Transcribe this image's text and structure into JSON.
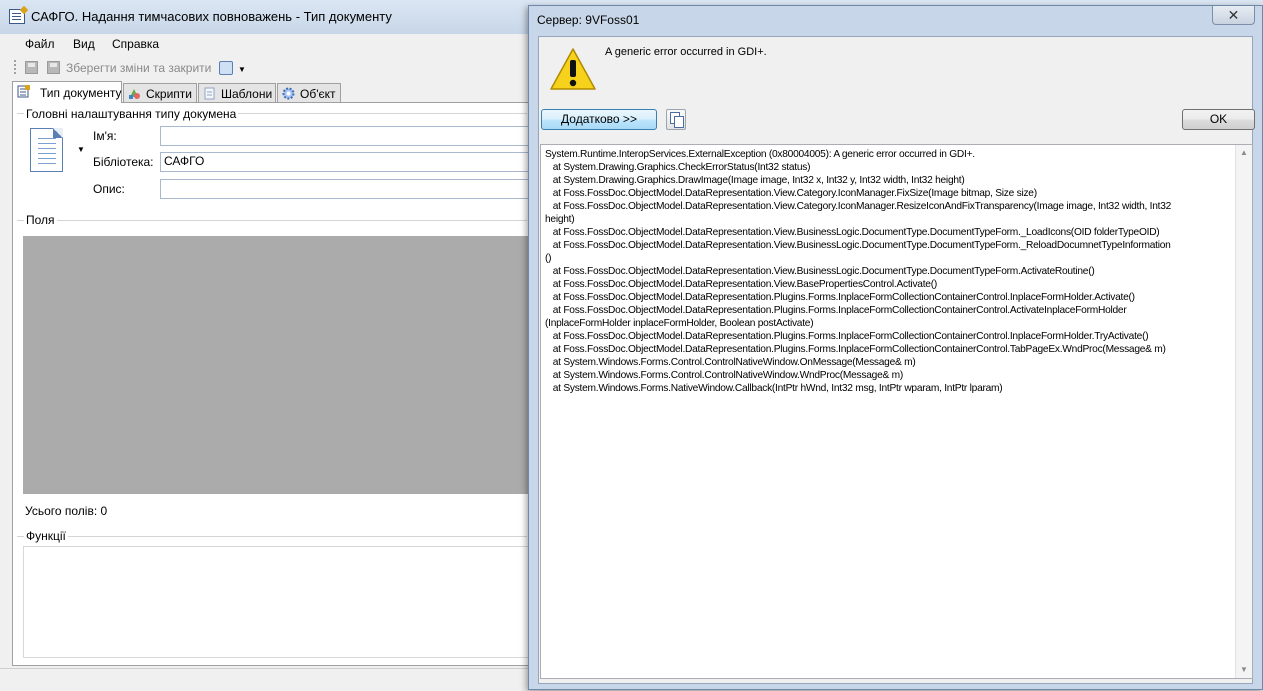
{
  "main_window": {
    "title": "САФГО. Надання тимчасових повноважень - Тип документу",
    "menu": [
      "Файл",
      "Вид",
      "Справка"
    ],
    "toolbar": {
      "save_close_label": "Зберегти зміни та закрити"
    },
    "tabs": [
      {
        "label": "Тип документу",
        "icon": "doc-type-icon",
        "active": true
      },
      {
        "label": "Скрипти",
        "icon": "scripts-icon",
        "active": false
      },
      {
        "label": "Шаблони",
        "icon": "templates-icon",
        "active": false
      },
      {
        "label": "Об'єкт",
        "icon": "object-icon",
        "active": false
      }
    ],
    "general": {
      "group_title": "Головні налаштування типу докумена",
      "name_label": "Ім'я:",
      "name_value": "",
      "library_label": "Бібліотека:",
      "library_value": "САФГО",
      "description_label": "Опис:",
      "description_value": ""
    },
    "fields": {
      "group_title": "Поля",
      "total_label": "Усього полів: 0"
    },
    "functions": {
      "group_title": "Функції"
    }
  },
  "dialog": {
    "title": "Сервер: 9VFoss01",
    "close_glyph": "✕",
    "message": "A generic error occurred in GDI+.",
    "more_button": "Додатково >>",
    "ok_button": "OK",
    "details": "System.Runtime.InteropServices.ExternalException (0x80004005): A generic error occurred in GDI+.\n   at System.Drawing.Graphics.CheckErrorStatus(Int32 status)\n   at System.Drawing.Graphics.DrawImage(Image image, Int32 x, Int32 y, Int32 width, Int32 height)\n   at Foss.FossDoc.ObjectModel.DataRepresentation.View.Category.IconManager.FixSize(Image bitmap, Size size)\n   at Foss.FossDoc.ObjectModel.DataRepresentation.View.Category.IconManager.ResizeIconAndFixTransparency(Image image, Int32 width, Int32\nheight)\n   at Foss.FossDoc.ObjectModel.DataRepresentation.View.BusinessLogic.DocumentType.DocumentTypeForm._LoadIcons(OID folderTypeOID)\n   at Foss.FossDoc.ObjectModel.DataRepresentation.View.BusinessLogic.DocumentType.DocumentTypeForm._ReloadDocumnetTypeInformation\n()\n   at Foss.FossDoc.ObjectModel.DataRepresentation.View.BusinessLogic.DocumentType.DocumentTypeForm.ActivateRoutine()\n   at Foss.FossDoc.ObjectModel.DataRepresentation.View.BasePropertiesControl.Activate()\n   at Foss.FossDoc.ObjectModel.DataRepresentation.Plugins.Forms.InplaceFormCollectionContainerControl.InplaceFormHolder.Activate()\n   at Foss.FossDoc.ObjectModel.DataRepresentation.Plugins.Forms.InplaceFormCollectionContainerControl.ActivateInplaceFormHolder\n(InplaceFormHolder inplaceFormHolder, Boolean postActivate)\n   at Foss.FossDoc.ObjectModel.DataRepresentation.Plugins.Forms.InplaceFormCollectionContainerControl.InplaceFormHolder.TryActivate()\n   at Foss.FossDoc.ObjectModel.DataRepresentation.Plugins.Forms.InplaceFormCollectionContainerControl.TabPageEx.WndProc(Message& m)\n   at System.Windows.Forms.Control.ControlNativeWindow.OnMessage(Message& m)\n   at System.Windows.Forms.Control.ControlNativeWindow.WndProc(Message& m)\n   at System.Windows.Forms.NativeWindow.Callback(IntPtr hWnd, Int32 msg, IntPtr wparam, IntPtr lparam)"
  },
  "colors": {
    "titlebar": "#c7d6e8",
    "fields_area": "#ababab",
    "warning_yellow": "#f7d21c"
  }
}
